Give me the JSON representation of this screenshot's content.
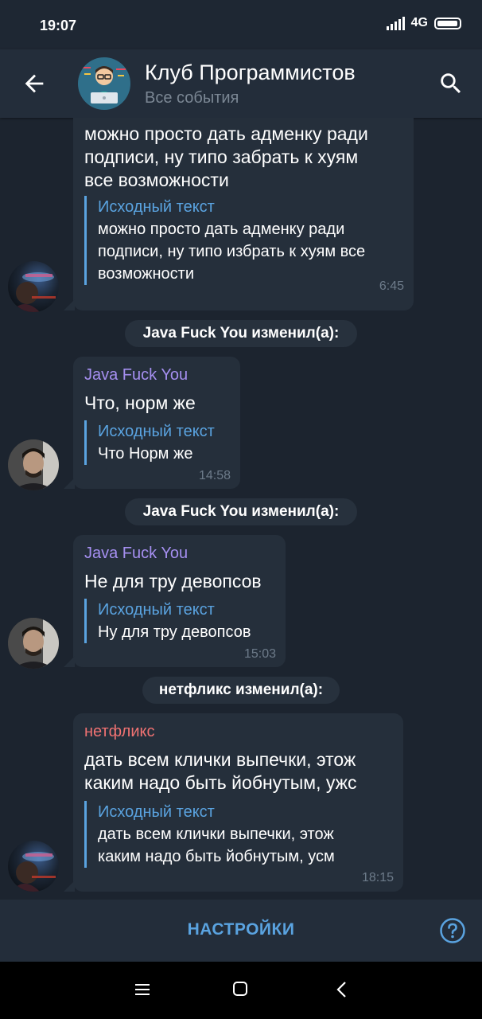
{
  "status": {
    "time": "19:07",
    "network": "4G"
  },
  "header": {
    "title": "Клуб Программистов",
    "subtitle": "Все события"
  },
  "messages": [
    {
      "body": [
        "можно просто дать адменку ради",
        "подписи, ну типо забрать к хуям",
        "все возможности"
      ],
      "quote_title": "Исходный текст",
      "quote": [
        "можно просто дать адменку ради",
        "подписи, ну типо избрать к хуям все",
        "возможности"
      ],
      "time": "6:45"
    },
    {
      "service": "Java Fuck You изменил(а):"
    },
    {
      "sender": "Java Fuck You",
      "body": [
        "Что, норм же"
      ],
      "quote_title": "Исходный текст",
      "quote": [
        "Что Норм же"
      ],
      "time": "14:58"
    },
    {
      "service": "Java Fuck You изменил(а):"
    },
    {
      "sender": "Java Fuck You",
      "body": [
        "Не для тру девопсов"
      ],
      "quote_title": "Исходный текст",
      "quote": [
        "Ну для тру девопсов"
      ],
      "time": "15:03"
    },
    {
      "service": "нетфликс изменил(а):"
    },
    {
      "sender": "нетфликс",
      "body": [
        "дать всем клички выпечки, этож",
        "каким надо быть йобнутым, ужс"
      ],
      "quote_title": "Исходный текст",
      "quote": [
        "дать всем клички выпечки, этож",
        "каким надо быть йобнутым, усм"
      ],
      "time": "18:15"
    }
  ],
  "colors": {
    "sender_java": "#a58ff0",
    "sender_netflix": "#f07272",
    "accent": "#5aa3e0"
  },
  "footer": {
    "settings_label": "НАСТРОЙКИ"
  }
}
